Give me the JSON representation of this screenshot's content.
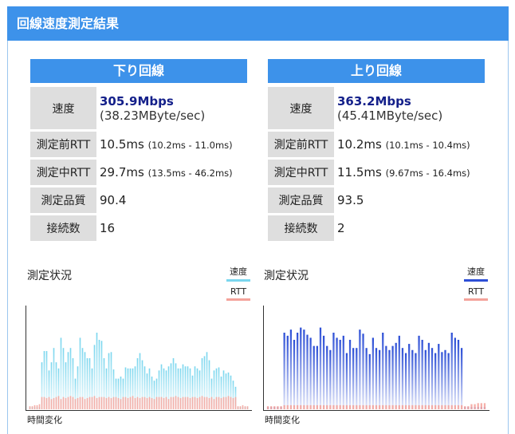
{
  "header": {
    "title": "回線速度測定結果"
  },
  "download": {
    "title": "下り回線",
    "speed_label": "速度",
    "speed": "305.9Mbps",
    "speed_bytes": "(38.23MByte/sec)",
    "rtt_before_label": "測定前RTT",
    "rtt_before": "10.5ms",
    "rtt_before_range": "(10.2ms - 11.0ms)",
    "rtt_during_label": "測定中RTT",
    "rtt_during": "29.7ms",
    "rtt_during_range": "(13.5ms - 46.2ms)",
    "quality_label": "測定品質",
    "quality": "90.4",
    "connections_label": "接続数",
    "connections": "16"
  },
  "upload": {
    "title": "上り回線",
    "speed_label": "速度",
    "speed": "363.2Mbps",
    "speed_bytes": "(45.41MByte/sec)",
    "rtt_before_label": "測定前RTT",
    "rtt_before": "10.2ms",
    "rtt_before_range": "(10.1ms - 10.4ms)",
    "rtt_during_label": "測定中RTT",
    "rtt_during": "11.5ms",
    "rtt_during_range": "(9.67ms - 16.4ms)",
    "quality_label": "測定品質",
    "quality": "93.5",
    "connections_label": "接続数",
    "connections": "2"
  },
  "graphs": {
    "title": "測定状況",
    "legend_speed": "速度",
    "legend_rtt": "RTT",
    "xlabel": "時間変化"
  },
  "colors": {
    "accent": "#3d92ea",
    "download_speed": "#7ad6ee",
    "upload_speed": "#2d4fd6",
    "rtt": "#f4a29a",
    "label_bg": "#dedede"
  },
  "chart_data": [
    {
      "type": "bar",
      "title": "測定状況",
      "xlabel": "時間変化",
      "ylabel": "",
      "ylim": [
        0,
        100
      ],
      "series": [
        {
          "name": "速度",
          "color": "#7ad6ee",
          "values": [
            2,
            2,
            2,
            2,
            2,
            46,
            57,
            57,
            38,
            46,
            60,
            46,
            40,
            70,
            60,
            46,
            56,
            60,
            50,
            30,
            42,
            70,
            60,
            56,
            50,
            50,
            40,
            63,
            75,
            68,
            67,
            50,
            40,
            55,
            56,
            39,
            30,
            30,
            32,
            30,
            41,
            40,
            40,
            40,
            42,
            50,
            55,
            48,
            42,
            35,
            40,
            32,
            28,
            30,
            38,
            44,
            40,
            38,
            42,
            45,
            50,
            45,
            40,
            40,
            44,
            42,
            42,
            40,
            33,
            42,
            40,
            38,
            50,
            52,
            56,
            48,
            30,
            38,
            40,
            41,
            32,
            38,
            35,
            36,
            33,
            28,
            22,
            2,
            2,
            2,
            2,
            2
          ]
        },
        {
          "name": "RTT",
          "color": "#f4a29a",
          "values": [
            3,
            3,
            4,
            4,
            5,
            12,
            12,
            11,
            12,
            10,
            11,
            12,
            13,
            10,
            12,
            11,
            12,
            13,
            12,
            10,
            11,
            12,
            12,
            10,
            11,
            12,
            12,
            13,
            11,
            12,
            12,
            12,
            11,
            12,
            11,
            12,
            12,
            11,
            10,
            12,
            12,
            11,
            12,
            13,
            11,
            12,
            11,
            12,
            12,
            11,
            12,
            11,
            10,
            12,
            12,
            12,
            11,
            12,
            10,
            12,
            12,
            13,
            12,
            11,
            12,
            12,
            12,
            11,
            12,
            12,
            11,
            12,
            13,
            12,
            12,
            11,
            12,
            10,
            12,
            12,
            11,
            12,
            12,
            13,
            12,
            11,
            12,
            3,
            3,
            4,
            3,
            3
          ]
        }
      ]
    },
    {
      "type": "bar",
      "title": "測定状況",
      "xlabel": "時間変化",
      "ylabel": "",
      "ylim": [
        0,
        100
      ],
      "series": [
        {
          "name": "速度",
          "color": "#2d4fd6",
          "values": [
            2,
            2,
            2,
            2,
            2,
            75,
            72,
            78,
            68,
            75,
            80,
            78,
            73,
            70,
            62,
            62,
            80,
            72,
            62,
            58,
            75,
            70,
            68,
            72,
            55,
            68,
            60,
            60,
            78,
            74,
            60,
            54,
            70,
            60,
            58,
            75,
            62,
            58,
            62,
            65,
            72,
            60,
            55,
            64,
            58,
            55,
            72,
            68,
            58,
            65,
            60,
            55,
            64,
            56,
            58,
            55,
            75,
            70,
            68,
            60,
            2,
            2,
            2,
            2,
            2,
            2,
            2
          ]
        },
        {
          "name": "RTT",
          "color": "#f4a29a",
          "values": [
            3,
            3,
            3,
            3,
            3,
            4,
            4,
            4,
            4,
            4,
            4,
            4,
            4,
            4,
            4,
            4,
            4,
            4,
            4,
            4,
            4,
            4,
            4,
            4,
            4,
            4,
            4,
            4,
            4,
            4,
            4,
            4,
            4,
            4,
            4,
            4,
            4,
            4,
            4,
            4,
            4,
            4,
            4,
            4,
            4,
            4,
            4,
            4,
            4,
            4,
            4,
            4,
            4,
            4,
            4,
            4,
            4,
            4,
            4,
            4,
            3,
            3,
            5,
            5,
            6,
            6,
            6
          ]
        }
      ]
    }
  ]
}
